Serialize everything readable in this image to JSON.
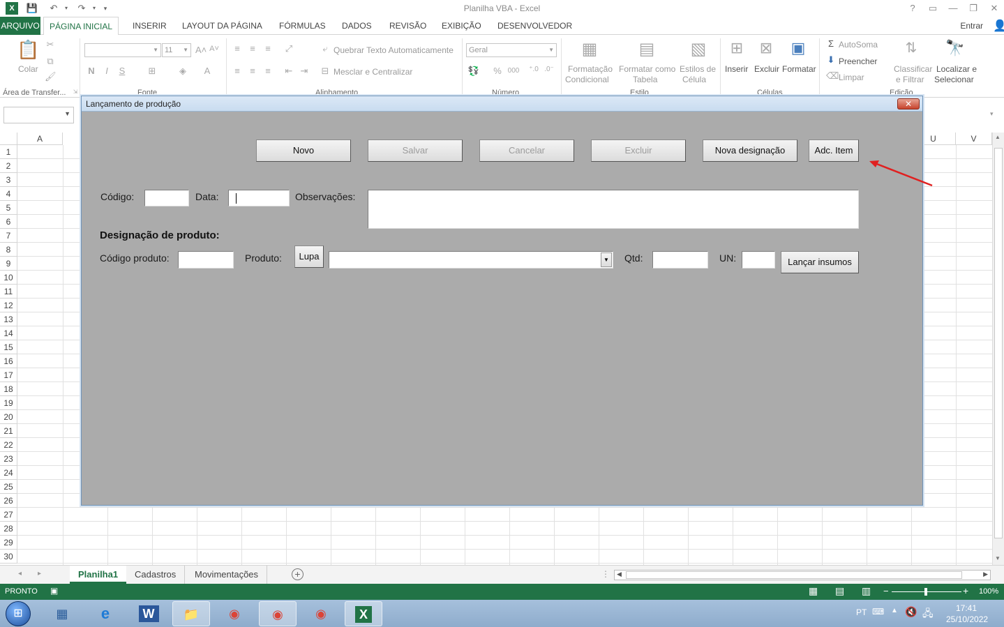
{
  "window": {
    "title": "Planilha VBA - Excel",
    "help": "?",
    "sign_in": "Entrar"
  },
  "ribbon_tabs": [
    "ARQUIVO",
    "PÁGINA INICIAL",
    "INSERIR",
    "LAYOUT DA PÁGINA",
    "FÓRMULAS",
    "DADOS",
    "REVISÃO",
    "EXIBIÇÃO",
    "DESENVOLVEDOR"
  ],
  "ribbon": {
    "clipboard": {
      "paste": "Colar",
      "group": "Área de Transfer..."
    },
    "font": {
      "size": "11",
      "bold": "N",
      "italic": "I",
      "underline": "S",
      "group": "Fonte"
    },
    "alignment": {
      "wrap": "Quebrar Texto Automaticamente",
      "merge": "Mesclar e Centralizar",
      "group": "Alinhamento"
    },
    "number": {
      "format": "Geral",
      "percent": "%",
      "thousands": "000",
      "group": "Número"
    },
    "styles": {
      "conditional": [
        "Formatação",
        "Condicional"
      ],
      "as_table": [
        "Formatar como",
        "Tabela"
      ],
      "cell_styles": [
        "Estilos de",
        "Célula"
      ],
      "group": "Estilo"
    },
    "cells": {
      "insert": "Inserir",
      "delete": "Excluir",
      "format": "Formatar",
      "group": "Células"
    },
    "editing": {
      "autosum": "AutoSoma",
      "fill": "Preencher",
      "clear": "Limpar",
      "sort": [
        "Classificar",
        "e Filtrar"
      ],
      "find": [
        "Localizar e",
        "Selecionar"
      ],
      "group": "Edição"
    }
  },
  "grid": {
    "columns": [
      "A",
      "U",
      "V"
    ],
    "rows": [
      "1",
      "2",
      "3",
      "4",
      "5",
      "6",
      "7",
      "8",
      "9",
      "10",
      "11",
      "12",
      "13",
      "14",
      "15",
      "16",
      "17",
      "18",
      "19",
      "20",
      "21",
      "22",
      "23",
      "24",
      "25",
      "26",
      "27",
      "28",
      "29",
      "30"
    ]
  },
  "sheets": [
    "Planilha1",
    "Cadastros",
    "Movimentações"
  ],
  "status": {
    "ready": "PRONTO",
    "zoom": "100%"
  },
  "taskbar": {
    "lang": "PT",
    "time": "17:41",
    "date": "25/10/2022"
  },
  "userform": {
    "title": "Lançamento de produção",
    "close": "✕",
    "buttons": {
      "novo": "Novo",
      "salvar": "Salvar",
      "cancelar": "Cancelar",
      "excluir": "Excluir",
      "nova_designacao": "Nova designação",
      "adc_item": "Adc. Item"
    },
    "labels": {
      "codigo": "Código:",
      "data": "Data:",
      "observacoes": "Observações:",
      "designacao": "Designação de produto:",
      "codigo_produto": "Código produto:",
      "produto": "Produto:",
      "lupa": "Lupa",
      "qtd": "Qtd:",
      "un": "UN:",
      "lancar_insumos": "Lançar insumos"
    },
    "values": {
      "codigo": "",
      "data": "",
      "observacoes": "",
      "codigo_produto": "",
      "produto": "",
      "qtd": "",
      "un": ""
    }
  },
  "colors": {
    "excel_green": "#217346",
    "form_bg": "#ababab",
    "arrow": "#e02020"
  }
}
